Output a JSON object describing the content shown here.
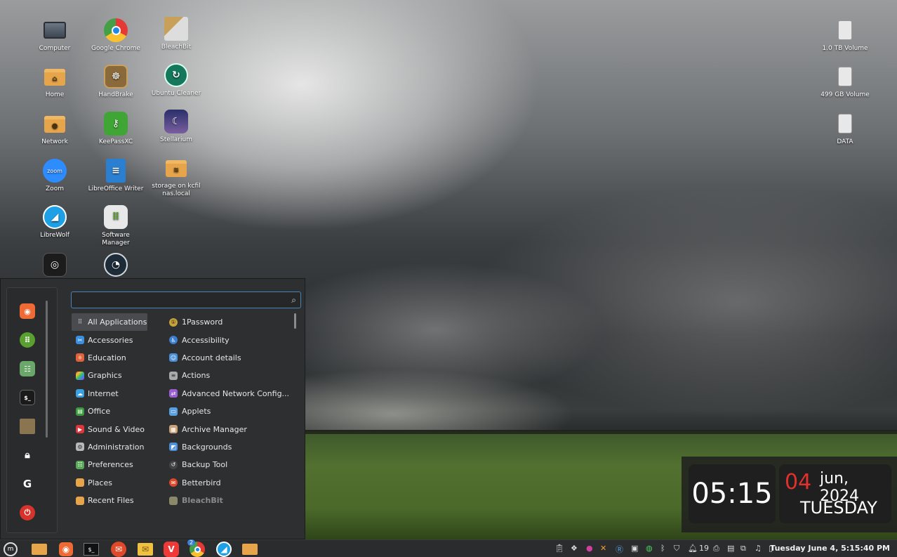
{
  "desktop": {
    "icons_col1": [
      {
        "label": "Computer",
        "icon": "monitor-icon"
      },
      {
        "label": "Home",
        "icon": "home-folder-icon"
      },
      {
        "label": "Network",
        "icon": "network-folder-icon"
      },
      {
        "label": "Zoom",
        "icon": "zoom-icon"
      },
      {
        "label": "LibreWolf",
        "icon": "librewolf-icon"
      }
    ],
    "icons_col2": [
      {
        "label": "Google Chrome",
        "icon": "chrome-icon"
      },
      {
        "label": "HandBrake",
        "icon": "handbrake-icon"
      },
      {
        "label": "KeePassXC",
        "icon": "keepassxc-icon"
      },
      {
        "label": "LibreOffice Writer",
        "icon": "writer-icon"
      },
      {
        "label": "Software Manager",
        "icon": "software-manager-icon"
      }
    ],
    "icons_col3": [
      {
        "label": "BleachBit",
        "icon": "bleachbit-icon"
      },
      {
        "label": "Ubuntu Cleaner",
        "icon": "ubuntu-cleaner-icon"
      },
      {
        "label": "Stellarium",
        "icon": "stellarium-icon"
      },
      {
        "label": "storage on kcfil nas.local",
        "icon": "network-storage-icon"
      }
    ],
    "volumes": [
      {
        "label": "1.0 TB Volume"
      },
      {
        "label": "499 GB Volume"
      },
      {
        "label": "DATA"
      }
    ],
    "zoom_text": "zoom"
  },
  "widget": {
    "time": "05:15",
    "day": "04",
    "month_year": "jun, 2024",
    "weekday": "TUESDAY"
  },
  "menu": {
    "search_value": "",
    "categories": [
      {
        "label": "All Applications",
        "color": "#4a4b4e"
      },
      {
        "label": "Accessories",
        "color": "#3c8fdc"
      },
      {
        "label": "Education",
        "color": "#e0613a"
      },
      {
        "label": "Graphics",
        "color": "#c04fc9"
      },
      {
        "label": "Internet",
        "color": "#3aa0e0"
      },
      {
        "label": "Office",
        "color": "#3b9b3f"
      },
      {
        "label": "Sound & Video",
        "color": "#e0353a"
      },
      {
        "label": "Administration",
        "color": "#b8b8b8"
      },
      {
        "label": "Preferences",
        "color": "#5aa95a"
      },
      {
        "label": "Places",
        "color": "#e6a54a"
      },
      {
        "label": "Recent Files",
        "color": "#e6a54a"
      }
    ],
    "apps": [
      {
        "label": "1Password",
        "color": "#c7a339"
      },
      {
        "label": "Accessibility",
        "color": "#3c7fd0"
      },
      {
        "label": "Account details",
        "color": "#4a8fd8"
      },
      {
        "label": "Actions",
        "color": "#aaaaaa"
      },
      {
        "label": "Advanced Network Config...",
        "color": "#9a5fd0"
      },
      {
        "label": "Applets",
        "color": "#5aa0e0"
      },
      {
        "label": "Archive Manager",
        "color": "#c9a27a"
      },
      {
        "label": "Backgrounds",
        "color": "#4a8fd8"
      },
      {
        "label": "Backup Tool",
        "color": "#666666"
      },
      {
        "label": "Betterbird",
        "color": "#e0482a"
      },
      {
        "label": "BleachBit",
        "color": "#8a8a6a"
      }
    ]
  },
  "panel": {
    "clock": "Tuesday June  4,  5:15:40 PM",
    "notification_count": "19",
    "chrome_badge": "2"
  }
}
